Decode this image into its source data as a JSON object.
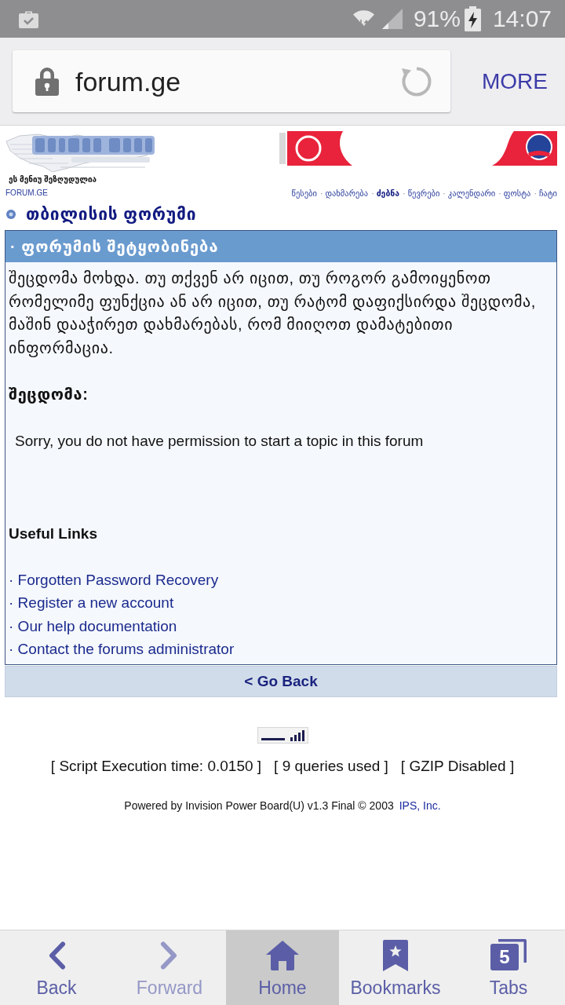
{
  "status_bar": {
    "battery": "91%",
    "time": "14:07"
  },
  "browser_toolbar": {
    "address": "forum.ge",
    "more_button": "MORE"
  },
  "forum_header": {
    "menu_notice": "ეს მენიუ შეზღუდულია",
    "site_link": "FORUM.GE",
    "nav_links": [
      {
        "label": "წესები",
        "selected": false
      },
      {
        "bullet": "·",
        "label": "დახმარება",
        "selected": false
      },
      {
        "bullet": "·",
        "label": "ძებნა",
        "selected": true
      },
      {
        "bullet": "·",
        "label": "წევრები",
        "selected": false
      },
      {
        "bullet": "·",
        "label": "კალენდარი",
        "selected": false
      },
      {
        "bullet": "·",
        "label": "ფოსტა",
        "selected": false
      },
      {
        "bullet": "·",
        "label": "ჩატი",
        "selected": false
      }
    ]
  },
  "board_title": "თბილისის ფორუმი",
  "message_box": {
    "title": "· ფორუმის შეტყობინება",
    "intro": "შეცდომა მოხდა. თუ თქვენ არ იცით, თუ როგორ გამოიყენოთ რომელიმე ფუნქცია ან არ იცით, თუ რატომ დაფიქსირდა შეცდომა, მაშინ დააჭირეთ დახმარებას, რომ მიიღოთ დამატებითი ინფორმაცია.",
    "error_label": "შეცდომა:",
    "error_message": "Sorry, you do not have permission to start a topic in this forum",
    "links_heading": "Useful Links",
    "links": [
      "· Forgotten Password Recovery",
      "· Register a new account",
      "· Our help documentation",
      "· Contact the forums administrator"
    ]
  },
  "go_back": "< Go Back",
  "footer": {
    "stats": [
      "[ Script Execution time: 0.0150 ]",
      "[ 9 queries used ]",
      "[ GZIP Disabled ]"
    ],
    "powered_by": "Powered by Invision Power Board(U) v1.3 Final © 2003",
    "company_link": "IPS, Inc."
  },
  "bottom_nav": [
    {
      "kind": "back",
      "label": "Back",
      "selected": false,
      "disabled": false
    },
    {
      "kind": "forward",
      "label": "Forward",
      "selected": false,
      "disabled": true
    },
    {
      "kind": "home",
      "label": "Home",
      "selected": true,
      "disabled": false
    },
    {
      "kind": "bookmarks",
      "label": "Bookmarks",
      "selected": false,
      "disabled": false
    },
    {
      "kind": "tabs",
      "label": "Tabs",
      "selected": false,
      "disabled": false,
      "count": "5"
    }
  ]
}
